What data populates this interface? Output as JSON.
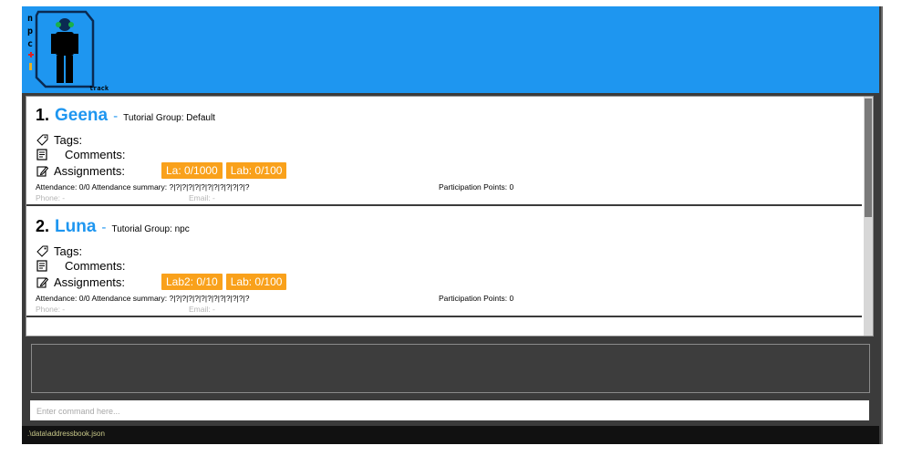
{
  "app": {
    "logo_text": "track",
    "logo_letters": [
      "n",
      "p",
      "c"
    ]
  },
  "persons": [
    {
      "index": "1.",
      "name": "Geena",
      "dash": "-",
      "tutorial_group": "Tutorial Group: Default",
      "tags_label": "Tags:",
      "comments_label": "Comments:",
      "assignments_label": "Assignments:",
      "assignments": [
        "La: 0/1000",
        "Lab: 0/100"
      ],
      "attendance": "Attendance: 0/0  Attendance summary: ?|?|?|?|?|?|?|?|?|?|?|?|?",
      "participation": "Participation Points: 0",
      "phone": "Phone: -",
      "email": "Email: -"
    },
    {
      "index": "2.",
      "name": "Luna",
      "dash": "-",
      "tutorial_group": "Tutorial Group: npc",
      "tags_label": "Tags:",
      "comments_label": "Comments:",
      "assignments_label": "Assignments:",
      "assignments": [
        "Lab2: 0/10",
        "Lab: 0/100"
      ],
      "attendance": "Attendance: 0/0  Attendance summary: ?|?|?|?|?|?|?|?|?|?|?|?|?",
      "participation": "Participation Points: 0",
      "phone": "Phone: -",
      "email": "Email: -"
    }
  ],
  "command": {
    "placeholder": "Enter command here..."
  },
  "status": {
    "path": ".\\data\\addressbook.json"
  },
  "colors": {
    "brand": "#1e96f0",
    "chip": "#f9a11b",
    "panel": "#3b3b3b"
  }
}
